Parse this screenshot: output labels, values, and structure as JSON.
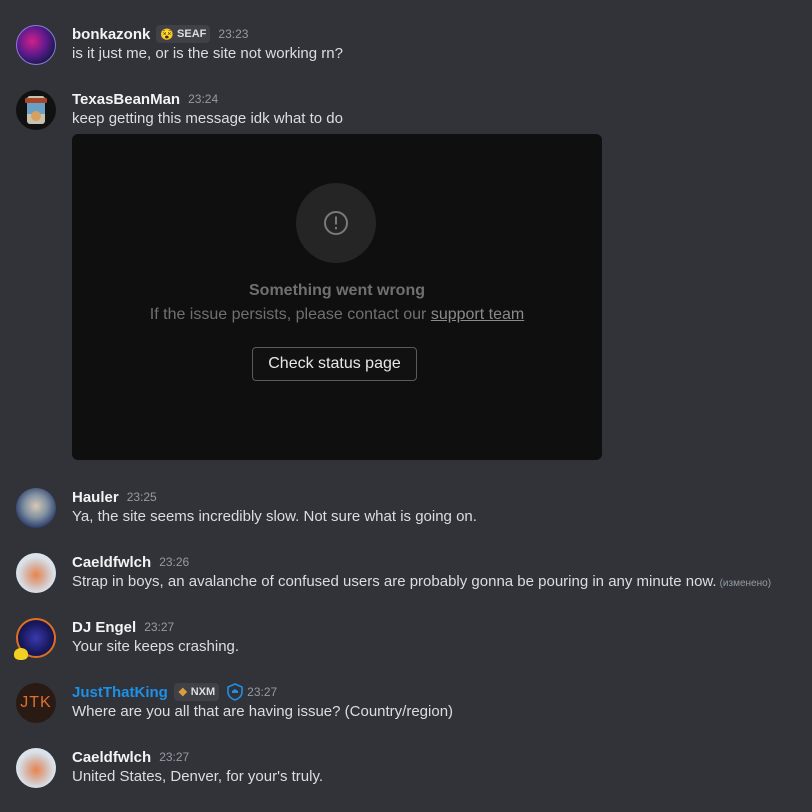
{
  "messages": [
    {
      "author": "bonkazonk",
      "tag": {
        "emoji": "😵",
        "label": "SEAF"
      },
      "time": "23:23",
      "text": "is it just me, or is the site not working rn?"
    },
    {
      "author": "TexasBeanMan",
      "time": "23:24",
      "text": "keep getting this message idk what to do",
      "embed": {
        "title": "Something went wrong",
        "subtitle_prefix": "If the issue persists, please contact our",
        "support_link": "support team",
        "button": "Check status page"
      }
    },
    {
      "author": "Hauler",
      "time": "23:25",
      "text": "Ya, the site seems incredibly slow. Not sure what is going on."
    },
    {
      "author": "Caeldfwlch",
      "time": "23:26",
      "text": "Strap in boys, an avalanche of confused users are probably gonna be pouring in any minute now.",
      "edited": "(изменено)"
    },
    {
      "author": "DJ Engel",
      "time": "23:27",
      "text": "Your site keeps crashing."
    },
    {
      "author": "JustThatKing",
      "author_color": "#1e90e6",
      "tag": {
        "emoji": "❖",
        "label": "NXM"
      },
      "time": "23:27",
      "text": "Where are you all that are having issue? (Country/region)"
    },
    {
      "author": "Caeldfwlch",
      "time": "23:27",
      "text": "United States, Denver, for your's truly."
    }
  ],
  "colors": {
    "background": "#313338",
    "embed_bg": "#0f0f0f",
    "mod_blue": "#1e90e6"
  }
}
